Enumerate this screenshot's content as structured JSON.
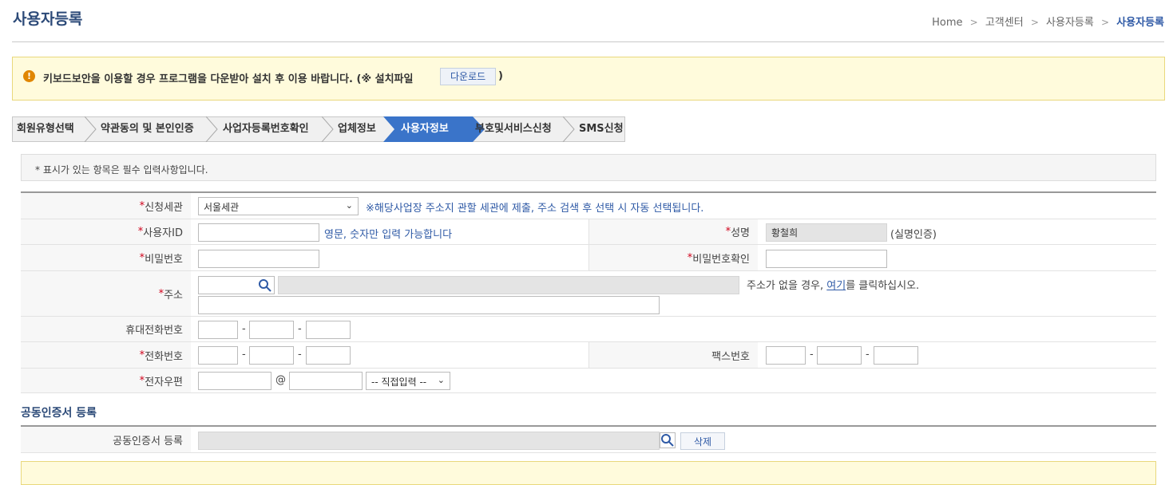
{
  "page": {
    "title": "사용자등록"
  },
  "breadcrumb": {
    "home": "Home",
    "level1": "고객센터",
    "level2": "사용자등록",
    "current": "사용자등록",
    "separator": ">"
  },
  "notice": {
    "icon": "exclamation-icon",
    "text": "키보드보안을 이용할 경우 프로그램을 다운받아 설치 후 이용 바랍니다. (※ 설치파일",
    "download_label": "다운로드",
    "close_paren": ")"
  },
  "steps": [
    {
      "label": "회원유형선택",
      "active": false
    },
    {
      "label": "약관동의 및 본인인증",
      "active": false
    },
    {
      "label": "사업자등록번호확인",
      "active": false
    },
    {
      "label": "업체정보",
      "active": false
    },
    {
      "label": "사용자정보",
      "active": true
    },
    {
      "label": "부호및서비스신청",
      "active": false
    },
    {
      "label": "SMS신청",
      "active": false
    }
  ],
  "required_note": "* 표시가 있는 항목은 필수 입력사항입니다.",
  "form": {
    "star": "*",
    "customs": {
      "label": "신청세관",
      "selected": "서울세관",
      "hint": "※해당사업장 주소지 관할 세관에 제출, 주소 검색 후 선택 시 자동 선택됩니다."
    },
    "user_id": {
      "label": "사용자ID",
      "value": "",
      "hint": "영문, 숫자만 입력 가능합니다"
    },
    "name": {
      "label": "성명",
      "value": "황철희",
      "note": "(실명인증)"
    },
    "password": {
      "label": "비밀번호",
      "value": ""
    },
    "password_confirm": {
      "label": "비밀번호확인",
      "value": ""
    },
    "address": {
      "label": "주소",
      "hint_before": "주소가 없을 경우,",
      "hint_link": "여기",
      "hint_after": "를 클릭하십시오."
    },
    "mobile": {
      "label": "휴대전화번호",
      "dash": "-"
    },
    "phone": {
      "label": "전화번호",
      "dash": "-"
    },
    "fax": {
      "label": "팩스번호",
      "dash": "-"
    },
    "email": {
      "label": "전자우편",
      "at": "@",
      "domain_select": "-- 직접입력 --"
    }
  },
  "cert": {
    "section_title": "공동인증서 등록",
    "label": "공동인증서 등록",
    "delete_label": "삭제"
  },
  "colors": {
    "accent": "#3a74c9",
    "title": "#2c4a78",
    "required": "#d0021b",
    "notice_bg": "#fffbdc"
  }
}
